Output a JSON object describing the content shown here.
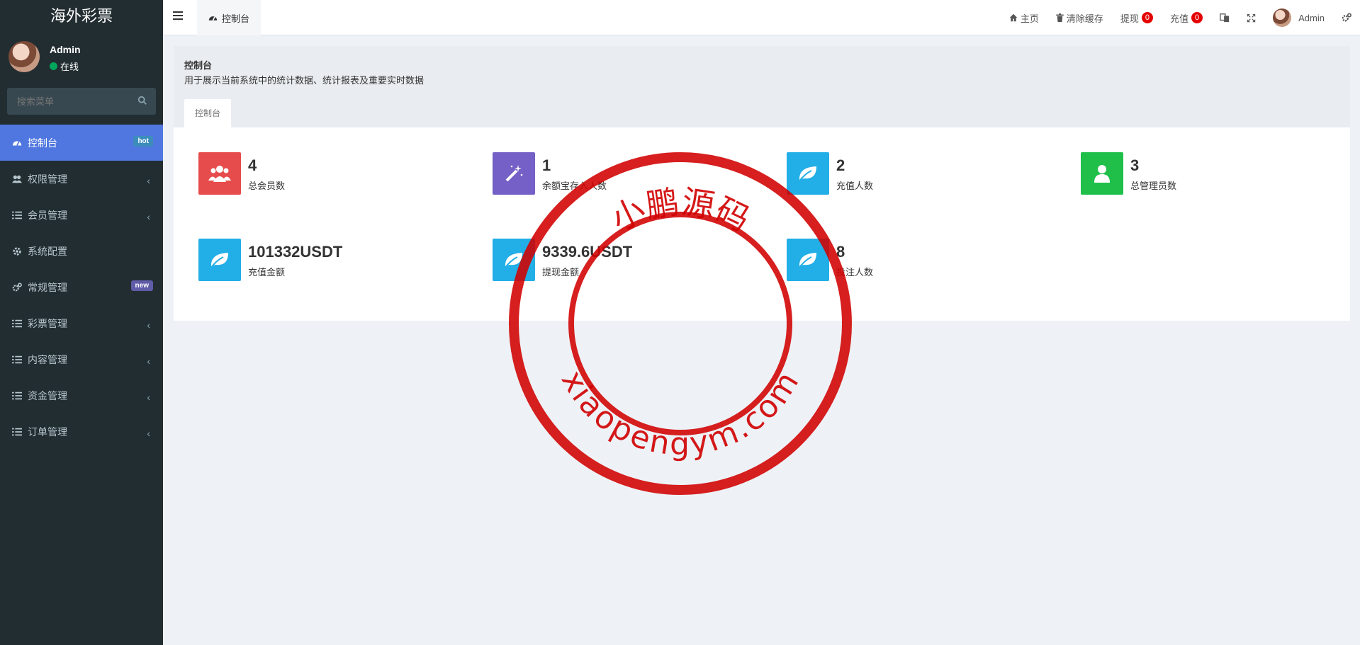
{
  "brand": {
    "title": "海外彩票"
  },
  "user": {
    "name": "Admin",
    "status": "在线"
  },
  "search": {
    "placeholder": "搜索菜单"
  },
  "menu": {
    "items": [
      {
        "label": "控制台",
        "badge": "hot",
        "active": true
      },
      {
        "label": "权限管理"
      },
      {
        "label": "会员管理"
      },
      {
        "label": "系统配置"
      },
      {
        "label": "常规管理",
        "badge": "new"
      },
      {
        "label": "彩票管理"
      },
      {
        "label": "内容管理"
      },
      {
        "label": "资金管理"
      },
      {
        "label": "订单管理"
      }
    ]
  },
  "header": {
    "tab": "控制台",
    "home": "主页",
    "clear_cache": "清除缓存",
    "withdraw": "提现",
    "withdraw_count": "0",
    "recharge": "充值",
    "recharge_count": "0",
    "admin": "Admin"
  },
  "content": {
    "title": "控制台",
    "description": "用于展示当前系统中的统计数据、统计报表及重要实时数据",
    "tab": "控制台"
  },
  "stats": [
    {
      "value": "4",
      "label": "总会员数",
      "color": "#dd4b39",
      "icon": "users-icon"
    },
    {
      "value": "1",
      "label": "余额宝存入人数",
      "color": "#7460c6",
      "icon": "magic-icon"
    },
    {
      "value": "2",
      "label": "充值人数",
      "color": "#22aee6",
      "icon": "leaf-icon"
    },
    {
      "value": "3",
      "label": "总管理员数",
      "color": "#1fbf4a",
      "icon": "user-icon"
    },
    {
      "value": "101332USDT",
      "label": "充值金额",
      "color": "#22aee6",
      "icon": "leaf-icon"
    },
    {
      "value": "9339.6USDT",
      "label": "提现金额",
      "color": "#22aee6",
      "icon": "leaf-icon"
    },
    {
      "value": "8",
      "label": "投注人数",
      "color": "#22aee6",
      "icon": "leaf-icon"
    }
  ],
  "watermark": {
    "top_text": "小鹏源码",
    "bottom_text": "xiaopengym.com",
    "color": "#d10000"
  }
}
